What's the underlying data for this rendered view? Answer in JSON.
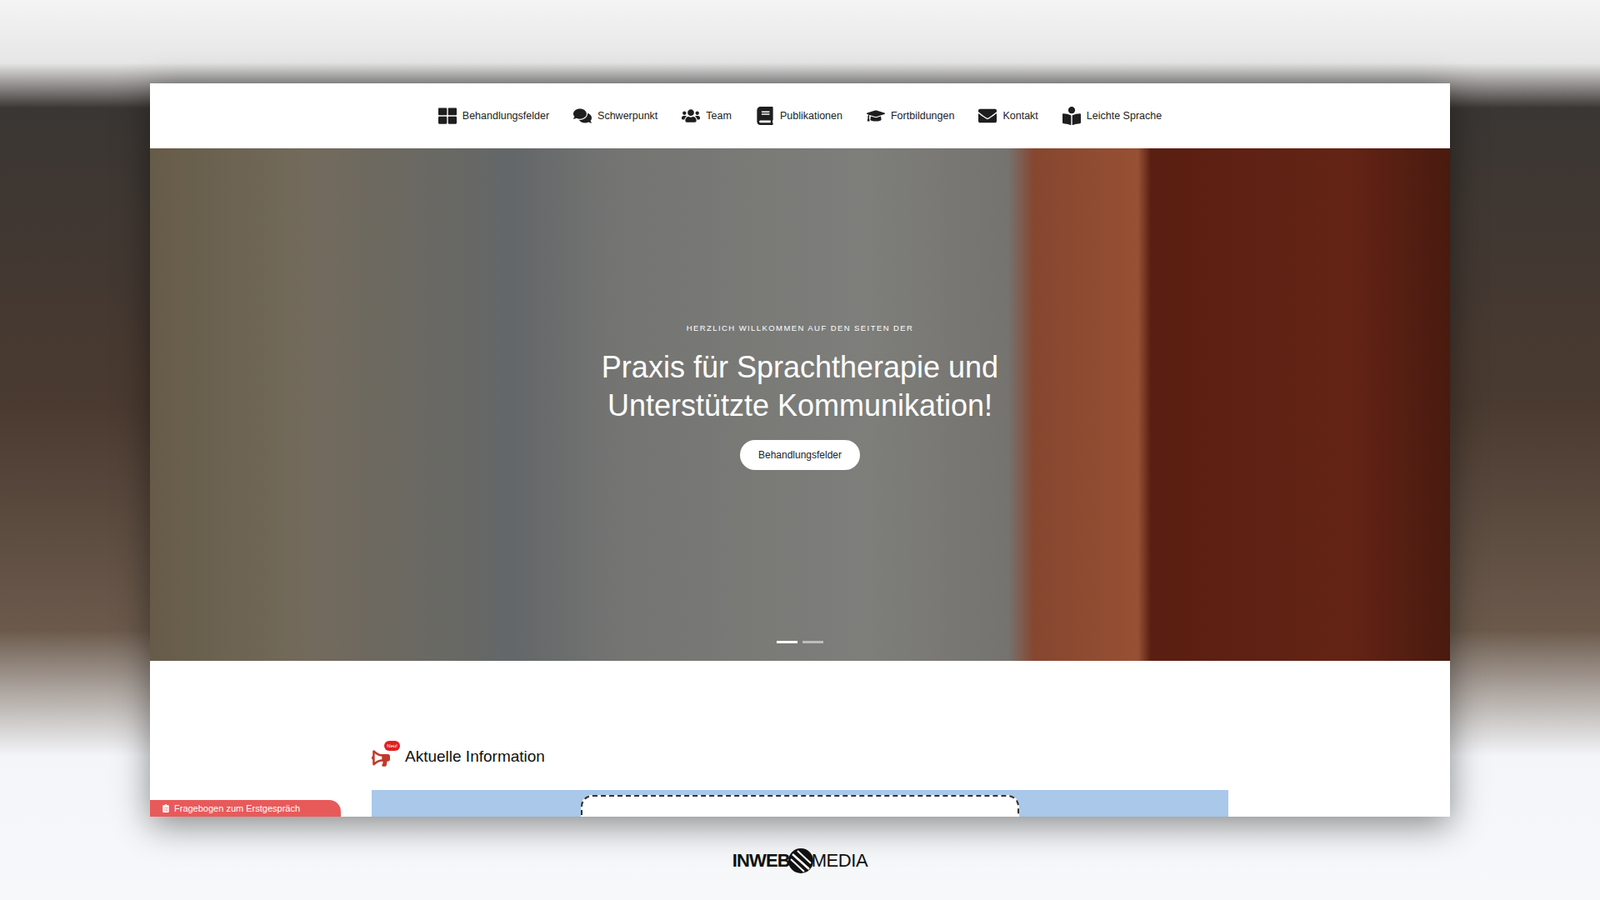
{
  "nav": {
    "items": [
      {
        "label": "Behandlungsfelder",
        "icon": "grid"
      },
      {
        "label": "Schwerpunkt",
        "icon": "comments"
      },
      {
        "label": "Team",
        "icon": "users"
      },
      {
        "label": "Publikationen",
        "icon": "book"
      },
      {
        "label": "Fortbildungen",
        "icon": "graduation"
      },
      {
        "label": "Kontakt",
        "icon": "envelope"
      },
      {
        "label": "Leichte Sprache",
        "icon": "reader"
      }
    ]
  },
  "hero": {
    "eyebrow": "HERZLICH WILLKOMMEN AUF DEN SEITEN DER",
    "title": "Praxis für Sprachtherapie und Unterstützte Kommunikation!",
    "button": "Behandlungsfelder",
    "slides": [
      {
        "selected": true
      },
      {
        "selected": false
      }
    ]
  },
  "news": {
    "heading": "Aktuelle Information",
    "badge": "Neu!"
  },
  "side_tab": {
    "label": "Fragebogen zum Erstgespräch"
  },
  "footer_brand": {
    "left": "INWEB",
    "right": "MEDIA"
  }
}
